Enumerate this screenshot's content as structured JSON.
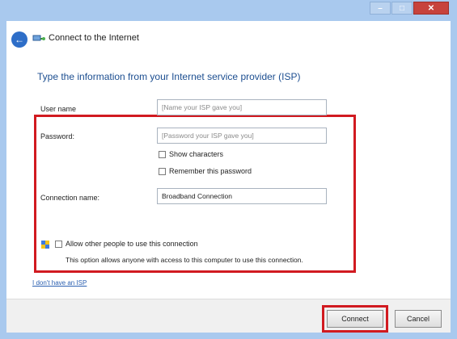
{
  "window": {
    "title": "Connect to the Internet"
  },
  "heading": "Type the information from your Internet service provider (ISP)",
  "form": {
    "username": {
      "label": "User name",
      "placeholder": "[Name your ISP gave you]"
    },
    "password": {
      "label": "Password:",
      "placeholder": "[Password your ISP gave you]"
    },
    "show_characters": "Show characters",
    "remember_password": "Remember this password",
    "connection_name": {
      "label": "Connection name:",
      "value": "Broadband Connection"
    }
  },
  "sharing": {
    "checkbox_label": "Allow other people to use this connection",
    "note": "This option allows anyone with access to this computer to use this connection."
  },
  "link_text": "I don't have an ISP",
  "buttons": {
    "connect": "Connect",
    "cancel": "Cancel"
  },
  "colors": {
    "accent": "#1c4e90",
    "highlight": "#d11a20",
    "frame": "#a9c9ee"
  }
}
